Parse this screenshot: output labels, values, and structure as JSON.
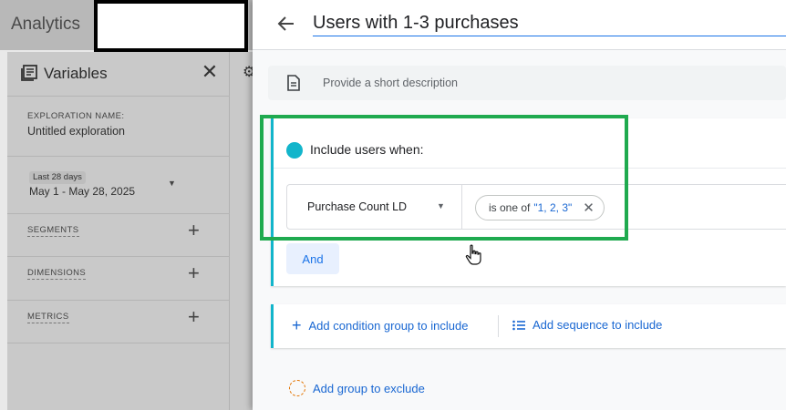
{
  "app": {
    "title": "Analytics"
  },
  "variables_panel": {
    "title": "Variables",
    "exploration_label": "EXPLORATION NAME:",
    "exploration_name": "Untitled exploration",
    "date_chip": "Last 28 days",
    "date_range": "May 1 - May 28, 2025",
    "sections": [
      {
        "label": "SEGMENTS"
      },
      {
        "label": "DIMENSIONS"
      },
      {
        "label": "METRICS"
      }
    ]
  },
  "segment_editor": {
    "name_value": "Users with 1-3 purchases",
    "description_placeholder": "Provide a short description",
    "include_title": "Include users when:",
    "condition": {
      "dimension": "Purchase Count LD",
      "operator": "is one of",
      "value": "\"1, 2, 3\""
    },
    "and_label": "And",
    "add_condition_group": "Add condition group to include",
    "add_sequence": "Add sequence to include",
    "add_exclude_group": "Add group to exclude"
  },
  "colors": {
    "include_accent": "#12b5cb",
    "link_blue": "#1967d2",
    "highlight_green": "#1faa4f",
    "exclude_orange": "#e37400"
  },
  "icons": [
    "variables-icon",
    "close-icon",
    "plus-icon",
    "gear-icon",
    "back-arrow-icon",
    "description-icon",
    "include-dot-icon",
    "dropdown-caret-icon",
    "chip-close-icon",
    "sequence-icon",
    "exclude-circle-icon",
    "hand-cursor-icon"
  ]
}
